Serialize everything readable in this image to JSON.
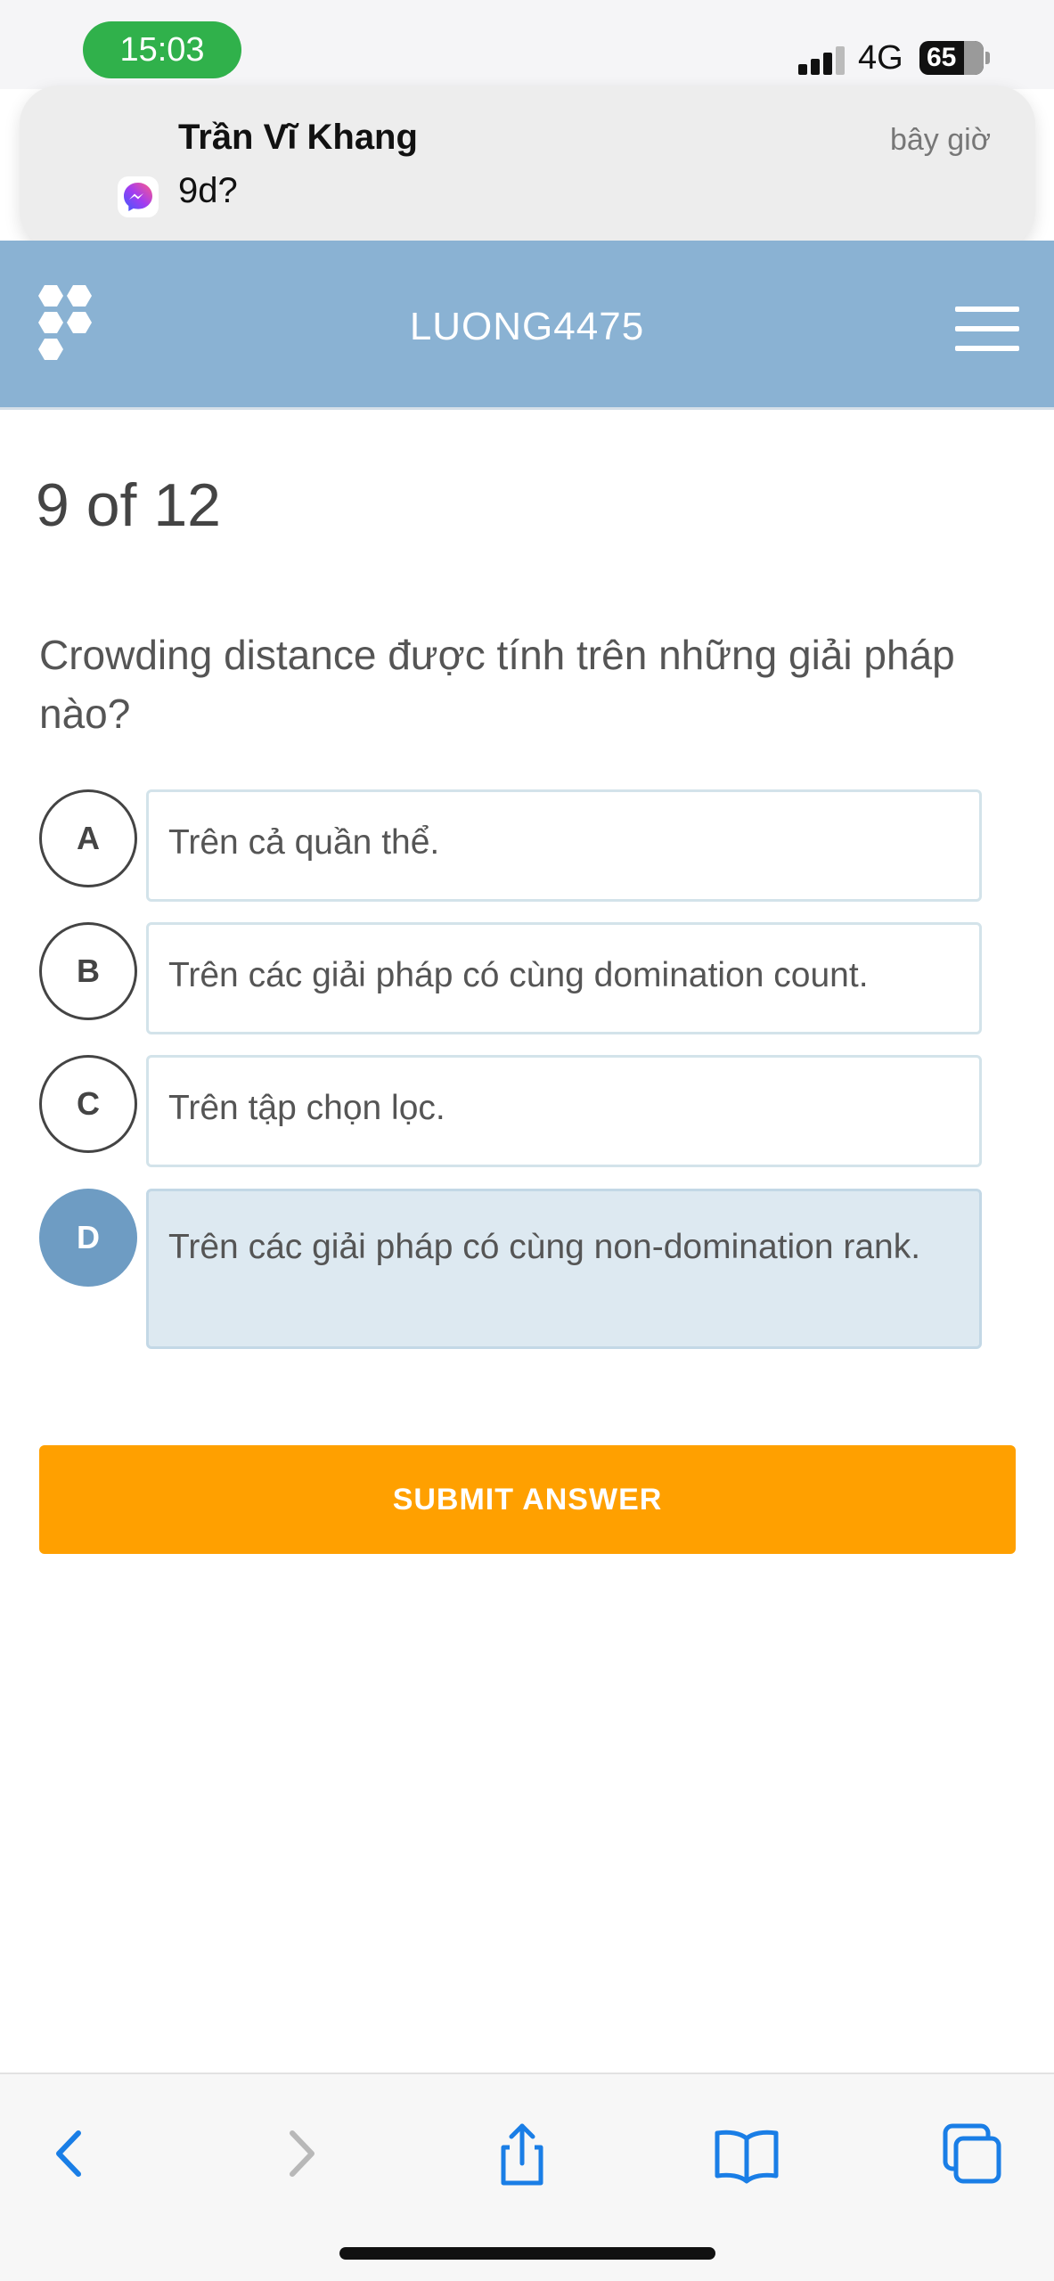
{
  "status_bar": {
    "time": "15:03",
    "network": "4G",
    "battery": "65",
    "time_pill_color": "#30b14b"
  },
  "notification": {
    "sender": "Trần Vĩ Khang",
    "time": "bây giờ",
    "message": "9d?",
    "app_icon": "messenger-icon"
  },
  "header": {
    "title": "LUONG4475",
    "background_color": "#8ab2d3",
    "logo_icon": "hexagon-logo-icon",
    "menu_icon": "hamburger-menu-icon"
  },
  "quiz": {
    "progress": "9 of 12",
    "question": "Crowding distance được tính trên những giải pháp nào?",
    "options": [
      {
        "letter": "A",
        "text": "Trên cả quần thể.",
        "selected": false
      },
      {
        "letter": "B",
        "text": "Trên các giải pháp có cùng domination count.",
        "selected": false
      },
      {
        "letter": "C",
        "text": "Trên tập chọn lọc.",
        "selected": false
      },
      {
        "letter": "D",
        "text": "Trên các giải pháp có cùng non-domination rank.",
        "selected": true
      }
    ],
    "submit_label": "SUBMIT ANSWER",
    "submit_color": "#ffa000",
    "selected_color": "#6e9cc3"
  },
  "browser_toolbar": {
    "icons": [
      "back-icon",
      "forward-icon",
      "share-icon",
      "bookmarks-icon",
      "tabs-icon"
    ],
    "accent_color": "#1a7ee6"
  }
}
